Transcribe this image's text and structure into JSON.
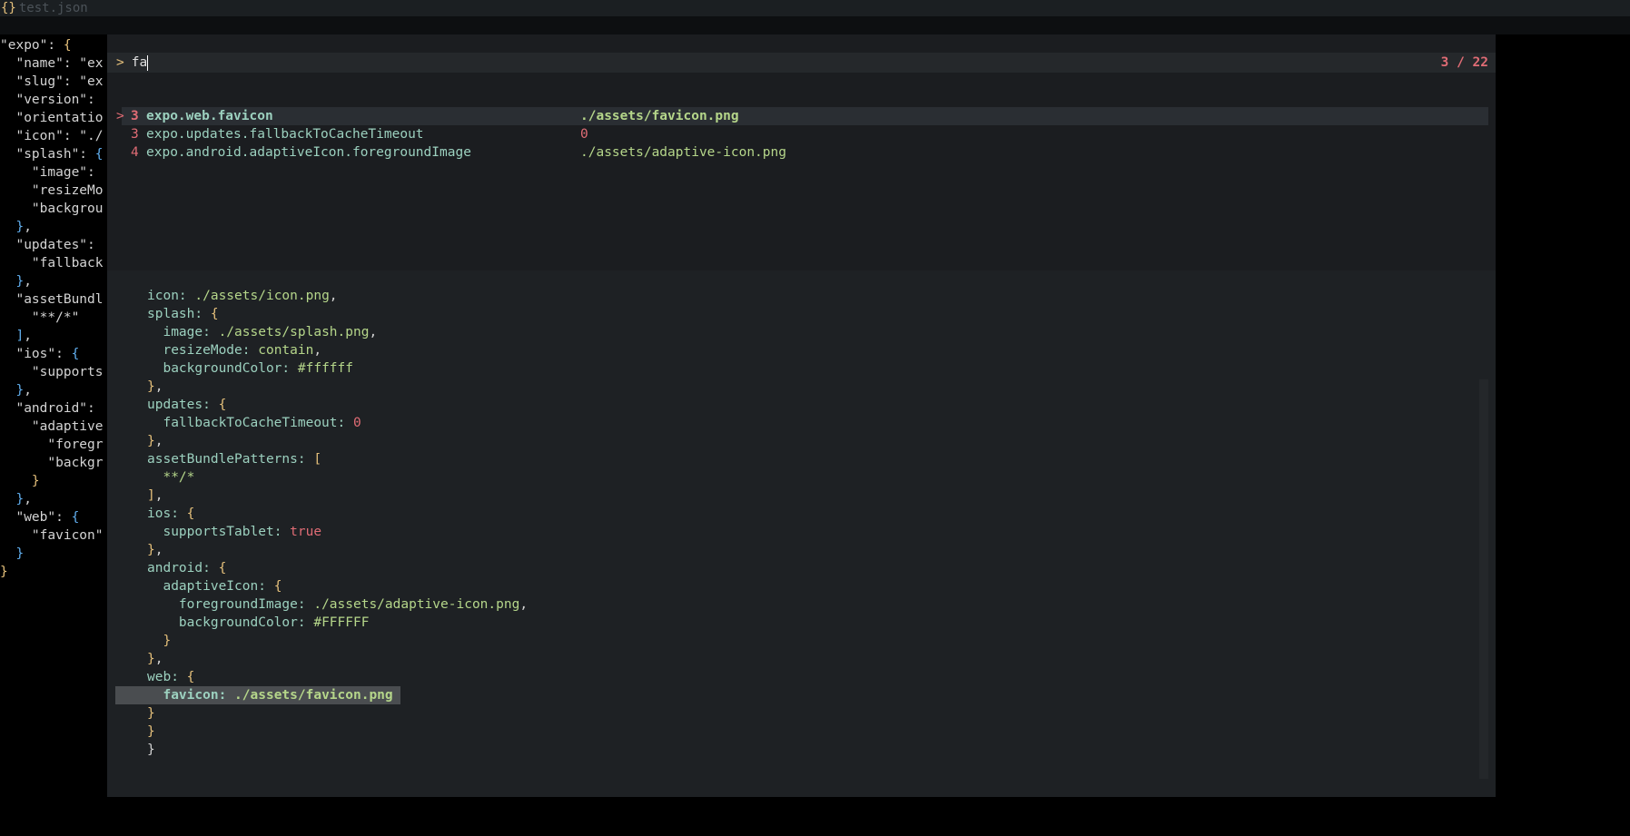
{
  "tab": {
    "icon": "{}",
    "filename": "test.json"
  },
  "editor_lines": [
    [
      {
        "t": "\"expo\"",
        "c": "s"
      },
      {
        "t": ": ",
        "c": "k"
      },
      {
        "t": "{",
        "c": "b1"
      }
    ],
    [
      {
        "t": "  \"name\": \"ex",
        "c": "s"
      }
    ],
    [
      {
        "t": "  \"slug\": \"ex",
        "c": "s"
      }
    ],
    [
      {
        "t": "  \"version\":",
        "c": "s"
      }
    ],
    [
      {
        "t": "  \"orientatio",
        "c": "s"
      }
    ],
    [
      {
        "t": "  \"icon\": \"./",
        "c": "s"
      }
    ],
    [
      {
        "t": "  \"splash\": ",
        "c": "s"
      },
      {
        "t": "{",
        "c": "b2"
      }
    ],
    [
      {
        "t": "    \"image\":",
        "c": "s"
      }
    ],
    [
      {
        "t": "    \"resizeMo",
        "c": "s"
      }
    ],
    [
      {
        "t": "    \"backgrou",
        "c": "s"
      }
    ],
    [
      {
        "t": "  ",
        "c": "s"
      },
      {
        "t": "}",
        "c": "b2"
      },
      {
        "t": ",",
        "c": "s"
      }
    ],
    [
      {
        "t": "  \"updates\":",
        "c": "s"
      }
    ],
    [
      {
        "t": "    \"fallback",
        "c": "s"
      }
    ],
    [
      {
        "t": "  ",
        "c": "s"
      },
      {
        "t": "}",
        "c": "b2"
      },
      {
        "t": ",",
        "c": "s"
      }
    ],
    [
      {
        "t": "  \"assetBundl",
        "c": "s"
      }
    ],
    [
      {
        "t": "    \"**/*\"",
        "c": "s"
      }
    ],
    [
      {
        "t": "  ",
        "c": "s"
      },
      {
        "t": "]",
        "c": "b2"
      },
      {
        "t": ",",
        "c": "s"
      }
    ],
    [
      {
        "t": "  \"ios\": ",
        "c": "s"
      },
      {
        "t": "{",
        "c": "b2"
      }
    ],
    [
      {
        "t": "    \"supports",
        "c": "s"
      }
    ],
    [
      {
        "t": "  ",
        "c": "s"
      },
      {
        "t": "}",
        "c": "b2"
      },
      {
        "t": ",",
        "c": "s"
      }
    ],
    [
      {
        "t": "  \"android\":",
        "c": "s"
      }
    ],
    [
      {
        "t": "    \"adaptive",
        "c": "s"
      }
    ],
    [
      {
        "t": "      \"foregr",
        "c": "s"
      }
    ],
    [
      {
        "t": "      \"backgr",
        "c": "s"
      }
    ],
    [
      {
        "t": "    ",
        "c": "s"
      },
      {
        "t": "}",
        "c": "b1"
      }
    ],
    [
      {
        "t": "  ",
        "c": "s"
      },
      {
        "t": "}",
        "c": "b2"
      },
      {
        "t": ",",
        "c": "s"
      }
    ],
    [
      {
        "t": "  \"web\": ",
        "c": "s"
      },
      {
        "t": "{",
        "c": "b2"
      }
    ],
    [
      {
        "t": "    \"favicon\"",
        "c": "s"
      }
    ],
    [
      {
        "t": "  ",
        "c": "s"
      },
      {
        "t": "}",
        "c": "b2"
      }
    ],
    [
      {
        "t": "}",
        "c": "b1"
      }
    ]
  ],
  "palette": {
    "prompt_symbol": ">",
    "query": "fa",
    "count": "3 / 22",
    "results": [
      {
        "marker": ">",
        "num": "3",
        "path": "expo.web.favicon",
        "value": "./assets/favicon.png",
        "value_type": "string",
        "selected": true
      },
      {
        "marker": "",
        "num": "3",
        "path": "expo.updates.fallbackToCacheTimeout",
        "value": "0",
        "value_type": "number",
        "selected": false
      },
      {
        "marker": "",
        "num": "4",
        "path": "expo.android.adaptiveIcon.foregroundImage",
        "value": "./assets/adaptive-icon.png",
        "value_type": "string",
        "selected": false
      }
    ]
  },
  "preview_lines": [
    [
      {
        "t": "icon",
        "c": "pk"
      },
      {
        "t": ": ",
        "c": "pk"
      },
      {
        "t": "./assets/icon.png",
        "c": "pv"
      },
      {
        "t": ",",
        "c": "pw"
      }
    ],
    [
      {
        "t": "splash",
        "c": "pk"
      },
      {
        "t": ": ",
        "c": "pk"
      },
      {
        "t": "{",
        "c": "py"
      }
    ],
    [
      {
        "t": "  image",
        "c": "pk"
      },
      {
        "t": ": ",
        "c": "pk"
      },
      {
        "t": "./assets/splash.png",
        "c": "pv"
      },
      {
        "t": ",",
        "c": "pw"
      }
    ],
    [
      {
        "t": "  resizeMode",
        "c": "pk"
      },
      {
        "t": ": ",
        "c": "pk"
      },
      {
        "t": "contain",
        "c": "pv"
      },
      {
        "t": ",",
        "c": "pw"
      }
    ],
    [
      {
        "t": "  backgroundColor",
        "c": "pk"
      },
      {
        "t": ": ",
        "c": "pk"
      },
      {
        "t": "#ffffff",
        "c": "pv"
      }
    ],
    [
      {
        "t": "}",
        "c": "py"
      },
      {
        "t": ",",
        "c": "pw"
      }
    ],
    [
      {
        "t": "updates",
        "c": "pk"
      },
      {
        "t": ": ",
        "c": "pk"
      },
      {
        "t": "{",
        "c": "py"
      }
    ],
    [
      {
        "t": "  fallbackToCacheTimeout",
        "c": "pk"
      },
      {
        "t": ": ",
        "c": "pk"
      },
      {
        "t": "0",
        "c": "pn"
      }
    ],
    [
      {
        "t": "}",
        "c": "py"
      },
      {
        "t": ",",
        "c": "pw"
      }
    ],
    [
      {
        "t": "assetBundlePatterns",
        "c": "pk"
      },
      {
        "t": ": ",
        "c": "pk"
      },
      {
        "t": "[",
        "c": "py"
      }
    ],
    [
      {
        "t": "  **/*",
        "c": "pv"
      }
    ],
    [
      {
        "t": "]",
        "c": "py"
      },
      {
        "t": ",",
        "c": "pw"
      }
    ],
    [
      {
        "t": "ios",
        "c": "pk"
      },
      {
        "t": ": ",
        "c": "pk"
      },
      {
        "t": "{",
        "c": "py"
      }
    ],
    [
      {
        "t": "  supportsTablet",
        "c": "pk"
      },
      {
        "t": ": ",
        "c": "pk"
      },
      {
        "t": "true",
        "c": "pn"
      }
    ],
    [
      {
        "t": "}",
        "c": "py"
      },
      {
        "t": ",",
        "c": "pw"
      }
    ],
    [
      {
        "t": "android",
        "c": "pk"
      },
      {
        "t": ": ",
        "c": "pk"
      },
      {
        "t": "{",
        "c": "py"
      }
    ],
    [
      {
        "t": "  adaptiveIcon",
        "c": "pk"
      },
      {
        "t": ": ",
        "c": "pk"
      },
      {
        "t": "{",
        "c": "py"
      }
    ],
    [
      {
        "t": "    foregroundImage",
        "c": "pk"
      },
      {
        "t": ": ",
        "c": "pk"
      },
      {
        "t": "./assets/adaptive-icon.png",
        "c": "pv"
      },
      {
        "t": ",",
        "c": "pw"
      }
    ],
    [
      {
        "t": "    backgroundColor",
        "c": "pk"
      },
      {
        "t": ": ",
        "c": "pk"
      },
      {
        "t": "#FFFFFF",
        "c": "pv"
      }
    ],
    [
      {
        "t": "  }",
        "c": "py"
      }
    ],
    [
      {
        "t": "}",
        "c": "py"
      },
      {
        "t": ",",
        "c": "pw"
      }
    ],
    [
      {
        "t": "web",
        "c": "pk"
      },
      {
        "t": ": ",
        "c": "pk"
      },
      {
        "t": "{",
        "c": "py"
      }
    ],
    [
      {
        "t": "  favicon",
        "c": "pk"
      },
      {
        "t": ": ",
        "c": "pk"
      },
      {
        "t": "./assets/favicon.png",
        "c": "pv"
      }
    ],
    [
      {
        "t": "}",
        "c": "py"
      }
    ],
    [
      {
        "t": "}",
        "c": "py"
      }
    ],
    [
      {
        "t": "}",
        "c": "pw"
      }
    ]
  ],
  "preview_highlight_line": 22,
  "colors": {
    "background": "#000000",
    "palette_bg": "#1b1d20",
    "accent_red": "#e06c75",
    "key_teal": "#9cd1bf",
    "string_green": "#b5d68a",
    "brace_yellow": "#e5c07b",
    "brace_blue": "#61afef"
  }
}
